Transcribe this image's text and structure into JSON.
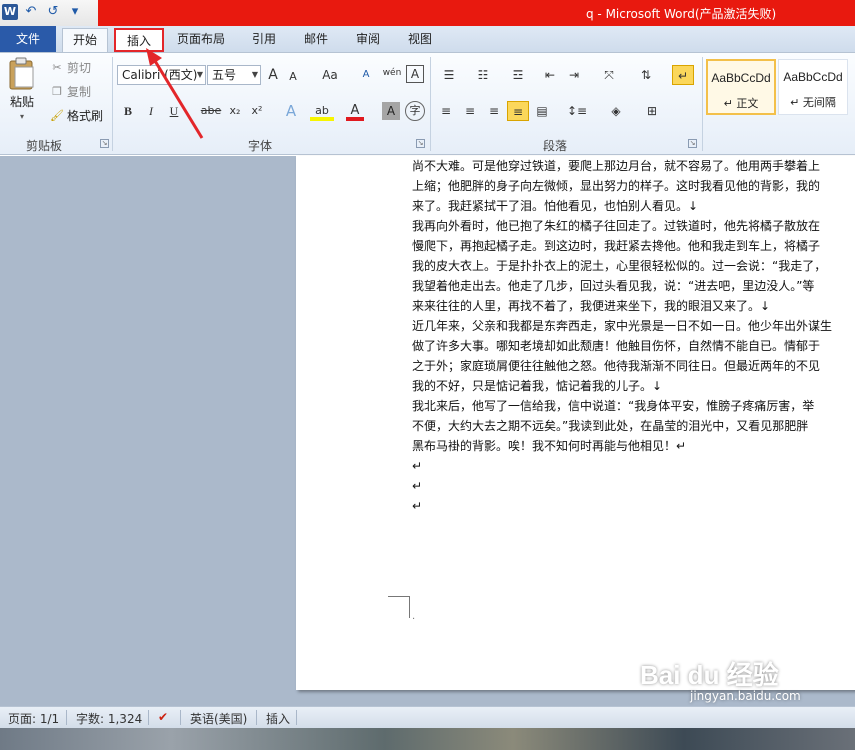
{
  "window": {
    "title": "q - Microsoft Word(产品激活失败)",
    "qat": {
      "app_icon": "W",
      "undo": "↶",
      "redo": "↺"
    }
  },
  "tabs": {
    "file": "文件",
    "items": [
      {
        "label": "开始",
        "state": "active"
      },
      {
        "label": "插入",
        "state": "highlighted"
      },
      {
        "label": "页面布局"
      },
      {
        "label": "引用"
      },
      {
        "label": "邮件"
      },
      {
        "label": "审阅"
      },
      {
        "label": "视图"
      }
    ]
  },
  "clipboard": {
    "paste": "粘贴",
    "cut": "剪切",
    "copy": "复制",
    "format_painter": "格式刷",
    "group_label": "剪贴板"
  },
  "font": {
    "font_name": "Calibri (西文)",
    "font_size": "五号",
    "group_label": "字体",
    "bold": "B",
    "italic": "I",
    "underline": "U",
    "strike": "abe",
    "sub": "x₂",
    "sup": "x²",
    "grow": "A",
    "shrink": "A",
    "case": "Aa",
    "clear": "A",
    "highlight": "ab",
    "color": "A",
    "wen": "wén",
    "wen2": "文",
    "charborder": "A",
    "charshade": "A",
    "circle": "字"
  },
  "paragraph": {
    "group_label": "段落"
  },
  "styles": {
    "items": [
      {
        "sample": "AaBbCcDd",
        "name": "↵ 正文"
      },
      {
        "sample": "AaBbCcDd",
        "name": "↵ 无间隔"
      }
    ]
  },
  "document": {
    "lines": [
      "尚不大难。可是他穿过铁道，要爬上那边月台，就不容易了。他用两手攀着上",
      "上缩；他肥胖的身子向左微倾，显出努力的样子。这时我看见他的背影，我的",
      "来了。我赶紧拭干了泪。怕他看见，也怕别人看见。↓",
      "我再向外看时，他已抱了朱红的橘子往回走了。过铁道时，他先将橘子散放在",
      "慢爬下，再抱起橘子走。到这边时，我赶紧去搀他。他和我走到车上，将橘子",
      "我的皮大衣上。于是扑扑衣上的泥土，心里很轻松似的。过一会说：“我走了，",
      "我望着他走出去。他走了几步，回过头看见我，说：“进去吧，里边没人。”等",
      "来来往往的人里，再找不着了，我便进来坐下，我的眼泪又来了。↓",
      "近几年来，父亲和我都是东奔西走，家中光景是一日不如一日。他少年出外谋生",
      "做了许多大事。哪知老境却如此颓唐！他触目伤怀，自然情不能自已。情郁于",
      "之于外；家庭琐屑便往往触他之怒。他待我渐渐不同往日。但最近两年的不见",
      "我的不好，只是惦记着我，惦记着我的儿子。↓",
      "我北来后，他写了一信给我，信中说道：“我身体平安，惟膀子疼痛厉害，举",
      "不便，大约大去之期不远矣。”我读到此处，在晶莹的泪光中，又看见那肥胖",
      "黑布马褂的背影。唉！我不知何时再能与他相见！↵"
    ],
    "empty_marks": [
      "↵",
      "↵",
      "↵"
    ],
    "end_mark": "·"
  },
  "status": {
    "page": "页面: 1/1",
    "words": "字数: 1,324",
    "language": "英语(美国)",
    "mode": "插入"
  },
  "watermark": {
    "logo": "Bai du 经验",
    "url": "jingyan.baidu.com"
  }
}
